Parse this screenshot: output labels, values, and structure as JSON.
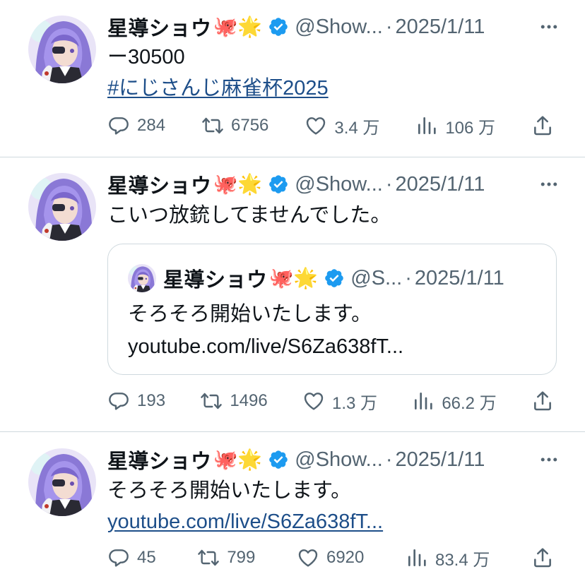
{
  "colors": {
    "text": "#0f1419",
    "secondary": "#536471",
    "link": "#1d4e89",
    "verified": "#1d9bf0",
    "border": "#cfd9de"
  },
  "icons": {
    "reply": "speech-bubble-icon",
    "retweet": "retweet-icon",
    "like": "heart-icon",
    "views": "bar-chart-icon",
    "share": "share-upload-icon",
    "more": "ellipsis-icon",
    "verified": "verified-badge-icon"
  },
  "tweets": [
    {
      "name": "星導ショウ",
      "emojis": "🐙🌟",
      "handle": "@Show...",
      "dot": "·",
      "date": "2025/1/11",
      "lines": [
        "ー30500"
      ],
      "hashtag": "#にじさんじ麻雀杯2025",
      "stats": {
        "replies": "284",
        "retweets": "6756",
        "likes": "3.4 万",
        "views": "106 万"
      }
    },
    {
      "name": "星導ショウ",
      "emojis": "🐙🌟",
      "handle": "@Show...",
      "dot": "·",
      "date": "2025/1/11",
      "lines": [
        "こいつ放銃してませんでした。"
      ],
      "quote": {
        "name": "星導ショウ",
        "emojis": "🐙🌟",
        "handle": "@S...",
        "dot": "·",
        "date": "2025/1/11",
        "lines": [
          "そろそろ開始いたします。",
          "youtube.com/live/S6Za638fT..."
        ]
      },
      "stats": {
        "replies": "193",
        "retweets": "1496",
        "likes": "1.3 万",
        "views": "66.2 万"
      }
    },
    {
      "name": "星導ショウ",
      "emojis": "🐙🌟",
      "handle": "@Show...",
      "dot": "·",
      "date": "2025/1/11",
      "lines": [
        "そろそろ開始いたします。"
      ],
      "link": "youtube.com/live/S6Za638fT...",
      "stats": {
        "replies": "45",
        "retweets": "799",
        "likes": "6920",
        "views": "83.4 万"
      }
    }
  ]
}
